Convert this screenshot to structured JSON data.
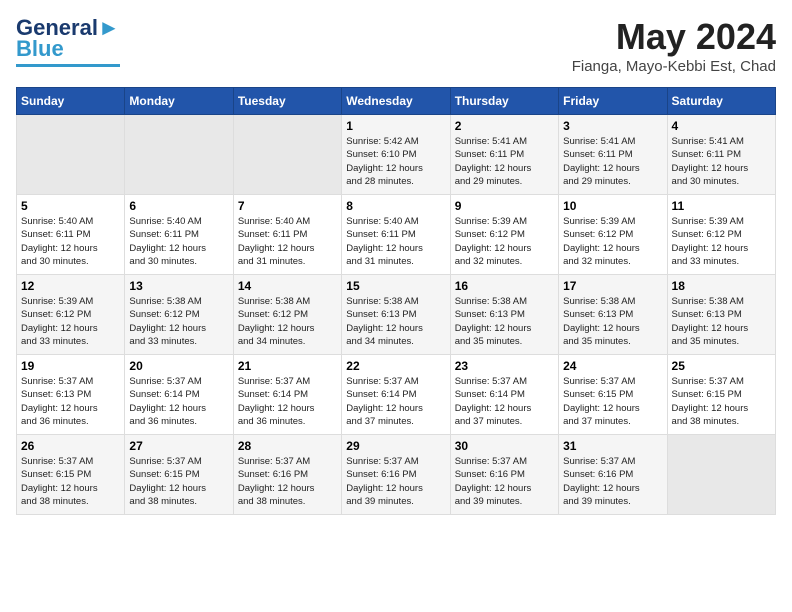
{
  "header": {
    "logo_line1": "General",
    "logo_line2": "Blue",
    "month": "May 2024",
    "location": "Fianga, Mayo-Kebbi Est, Chad"
  },
  "weekdays": [
    "Sunday",
    "Monday",
    "Tuesday",
    "Wednesday",
    "Thursday",
    "Friday",
    "Saturday"
  ],
  "weeks": [
    {
      "days": [
        {
          "num": "",
          "info": ""
        },
        {
          "num": "",
          "info": ""
        },
        {
          "num": "",
          "info": ""
        },
        {
          "num": "1",
          "info": "Sunrise: 5:42 AM\nSunset: 6:10 PM\nDaylight: 12 hours\nand 28 minutes."
        },
        {
          "num": "2",
          "info": "Sunrise: 5:41 AM\nSunset: 6:11 PM\nDaylight: 12 hours\nand 29 minutes."
        },
        {
          "num": "3",
          "info": "Sunrise: 5:41 AM\nSunset: 6:11 PM\nDaylight: 12 hours\nand 29 minutes."
        },
        {
          "num": "4",
          "info": "Sunrise: 5:41 AM\nSunset: 6:11 PM\nDaylight: 12 hours\nand 30 minutes."
        }
      ]
    },
    {
      "days": [
        {
          "num": "5",
          "info": "Sunrise: 5:40 AM\nSunset: 6:11 PM\nDaylight: 12 hours\nand 30 minutes."
        },
        {
          "num": "6",
          "info": "Sunrise: 5:40 AM\nSunset: 6:11 PM\nDaylight: 12 hours\nand 30 minutes."
        },
        {
          "num": "7",
          "info": "Sunrise: 5:40 AM\nSunset: 6:11 PM\nDaylight: 12 hours\nand 31 minutes."
        },
        {
          "num": "8",
          "info": "Sunrise: 5:40 AM\nSunset: 6:11 PM\nDaylight: 12 hours\nand 31 minutes."
        },
        {
          "num": "9",
          "info": "Sunrise: 5:39 AM\nSunset: 6:12 PM\nDaylight: 12 hours\nand 32 minutes."
        },
        {
          "num": "10",
          "info": "Sunrise: 5:39 AM\nSunset: 6:12 PM\nDaylight: 12 hours\nand 32 minutes."
        },
        {
          "num": "11",
          "info": "Sunrise: 5:39 AM\nSunset: 6:12 PM\nDaylight: 12 hours\nand 33 minutes."
        }
      ]
    },
    {
      "days": [
        {
          "num": "12",
          "info": "Sunrise: 5:39 AM\nSunset: 6:12 PM\nDaylight: 12 hours\nand 33 minutes."
        },
        {
          "num": "13",
          "info": "Sunrise: 5:38 AM\nSunset: 6:12 PM\nDaylight: 12 hours\nand 33 minutes."
        },
        {
          "num": "14",
          "info": "Sunrise: 5:38 AM\nSunset: 6:12 PM\nDaylight: 12 hours\nand 34 minutes."
        },
        {
          "num": "15",
          "info": "Sunrise: 5:38 AM\nSunset: 6:13 PM\nDaylight: 12 hours\nand 34 minutes."
        },
        {
          "num": "16",
          "info": "Sunrise: 5:38 AM\nSunset: 6:13 PM\nDaylight: 12 hours\nand 35 minutes."
        },
        {
          "num": "17",
          "info": "Sunrise: 5:38 AM\nSunset: 6:13 PM\nDaylight: 12 hours\nand 35 minutes."
        },
        {
          "num": "18",
          "info": "Sunrise: 5:38 AM\nSunset: 6:13 PM\nDaylight: 12 hours\nand 35 minutes."
        }
      ]
    },
    {
      "days": [
        {
          "num": "19",
          "info": "Sunrise: 5:37 AM\nSunset: 6:13 PM\nDaylight: 12 hours\nand 36 minutes."
        },
        {
          "num": "20",
          "info": "Sunrise: 5:37 AM\nSunset: 6:14 PM\nDaylight: 12 hours\nand 36 minutes."
        },
        {
          "num": "21",
          "info": "Sunrise: 5:37 AM\nSunset: 6:14 PM\nDaylight: 12 hours\nand 36 minutes."
        },
        {
          "num": "22",
          "info": "Sunrise: 5:37 AM\nSunset: 6:14 PM\nDaylight: 12 hours\nand 37 minutes."
        },
        {
          "num": "23",
          "info": "Sunrise: 5:37 AM\nSunset: 6:14 PM\nDaylight: 12 hours\nand 37 minutes."
        },
        {
          "num": "24",
          "info": "Sunrise: 5:37 AM\nSunset: 6:15 PM\nDaylight: 12 hours\nand 37 minutes."
        },
        {
          "num": "25",
          "info": "Sunrise: 5:37 AM\nSunset: 6:15 PM\nDaylight: 12 hours\nand 38 minutes."
        }
      ]
    },
    {
      "days": [
        {
          "num": "26",
          "info": "Sunrise: 5:37 AM\nSunset: 6:15 PM\nDaylight: 12 hours\nand 38 minutes."
        },
        {
          "num": "27",
          "info": "Sunrise: 5:37 AM\nSunset: 6:15 PM\nDaylight: 12 hours\nand 38 minutes."
        },
        {
          "num": "28",
          "info": "Sunrise: 5:37 AM\nSunset: 6:16 PM\nDaylight: 12 hours\nand 38 minutes."
        },
        {
          "num": "29",
          "info": "Sunrise: 5:37 AM\nSunset: 6:16 PM\nDaylight: 12 hours\nand 39 minutes."
        },
        {
          "num": "30",
          "info": "Sunrise: 5:37 AM\nSunset: 6:16 PM\nDaylight: 12 hours\nand 39 minutes."
        },
        {
          "num": "31",
          "info": "Sunrise: 5:37 AM\nSunset: 6:16 PM\nDaylight: 12 hours\nand 39 minutes."
        },
        {
          "num": "",
          "info": ""
        }
      ]
    }
  ]
}
